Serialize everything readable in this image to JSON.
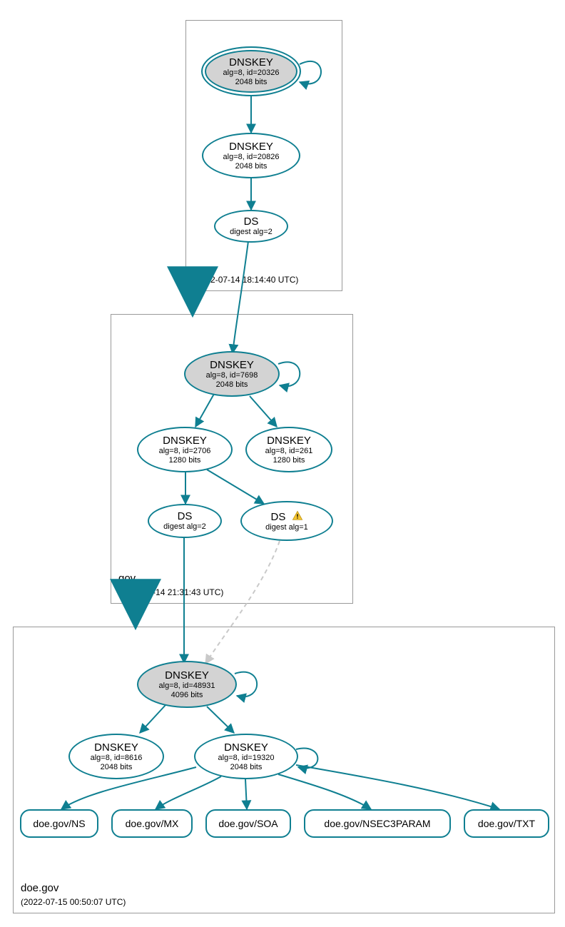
{
  "zones": {
    "root": {
      "name": ".",
      "ts": "(2022-07-14 18:14:40 UTC)"
    },
    "gov": {
      "name": "gov",
      "ts": "(2022-07-14 21:31:43 UTC)"
    },
    "doe": {
      "name": "doe.gov",
      "ts": "(2022-07-15 00:50:07 UTC)"
    }
  },
  "nodes": {
    "root_ksk": {
      "title": "DNSKEY",
      "sub1": "alg=8, id=20326",
      "sub2": "2048 bits"
    },
    "root_zsk": {
      "title": "DNSKEY",
      "sub1": "alg=8, id=20826",
      "sub2": "2048 bits"
    },
    "root_ds": {
      "title": "DS",
      "sub1": "digest alg=2"
    },
    "gov_ksk": {
      "title": "DNSKEY",
      "sub1": "alg=8, id=7698",
      "sub2": "2048 bits"
    },
    "gov_zsk_a": {
      "title": "DNSKEY",
      "sub1": "alg=8, id=2706",
      "sub2": "1280 bits"
    },
    "gov_zsk_b": {
      "title": "DNSKEY",
      "sub1": "alg=8, id=261",
      "sub2": "1280 bits"
    },
    "gov_ds_a": {
      "title": "DS",
      "sub1": "digest alg=2"
    },
    "gov_ds_b": {
      "title": "DS",
      "sub1": "digest alg=1",
      "warn": true
    },
    "doe_ksk": {
      "title": "DNSKEY",
      "sub1": "alg=8, id=48931",
      "sub2": "4096 bits"
    },
    "doe_zsk_a": {
      "title": "DNSKEY",
      "sub1": "alg=8, id=8616",
      "sub2": "2048 bits"
    },
    "doe_zsk_b": {
      "title": "DNSKEY",
      "sub1": "alg=8, id=19320",
      "sub2": "2048 bits"
    },
    "rr_ns": {
      "label": "doe.gov/NS"
    },
    "rr_mx": {
      "label": "doe.gov/MX"
    },
    "rr_soa": {
      "label": "doe.gov/SOA"
    },
    "rr_n3p": {
      "label": "doe.gov/NSEC3PARAM"
    },
    "rr_txt": {
      "label": "doe.gov/TXT"
    }
  }
}
